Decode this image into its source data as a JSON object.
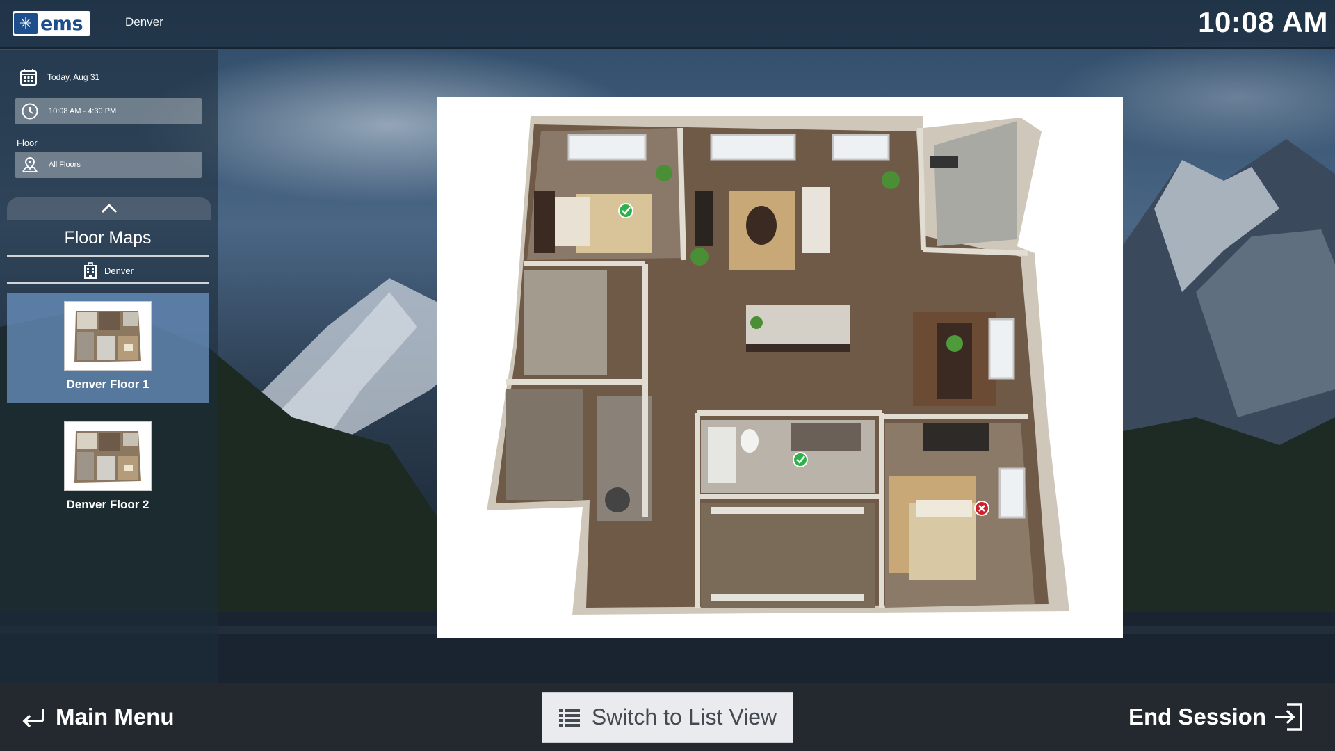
{
  "header": {
    "logo_text": "ems",
    "location": "Denver",
    "time": "10:08 AM"
  },
  "sidebar": {
    "date": "Today, Aug 31",
    "time_range": "10:08 AM - 4:30 PM",
    "floor_label": "Floor",
    "floor_value": "All Floors",
    "panel_title": "Floor Maps",
    "building": "Denver",
    "maps": [
      {
        "name": "Denver Floor 1",
        "selected": true
      },
      {
        "name": "Denver Floor 2",
        "selected": false
      }
    ]
  },
  "footer": {
    "main_menu": "Main Menu",
    "switch_view": "Switch to List View",
    "end_session": "End Session"
  },
  "colors": {
    "brand": "#1d4f8c",
    "available": "#2bb34a",
    "unavailable": "#d0202a",
    "selected_card": "#6e96c8"
  },
  "icons": {
    "calendar": "calendar-icon",
    "clock": "clock-icon",
    "location": "map-pin-icon",
    "building": "building-icon",
    "chevron": "chevron-up-icon",
    "back": "return-arrow-icon",
    "list": "list-icon",
    "exit": "exit-icon"
  }
}
